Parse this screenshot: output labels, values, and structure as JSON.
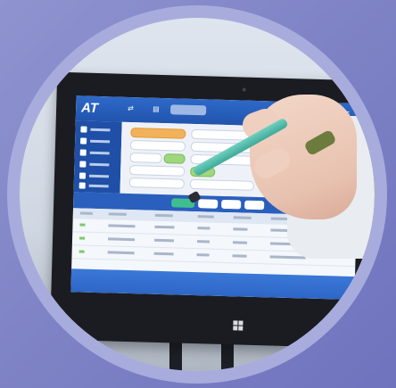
{
  "screen": {
    "logo": "AT",
    "colors": {
      "accent": "#2a5fbd",
      "highlight_orange": "#f2b25b",
      "highlight_green": "#9fd67e"
    }
  }
}
